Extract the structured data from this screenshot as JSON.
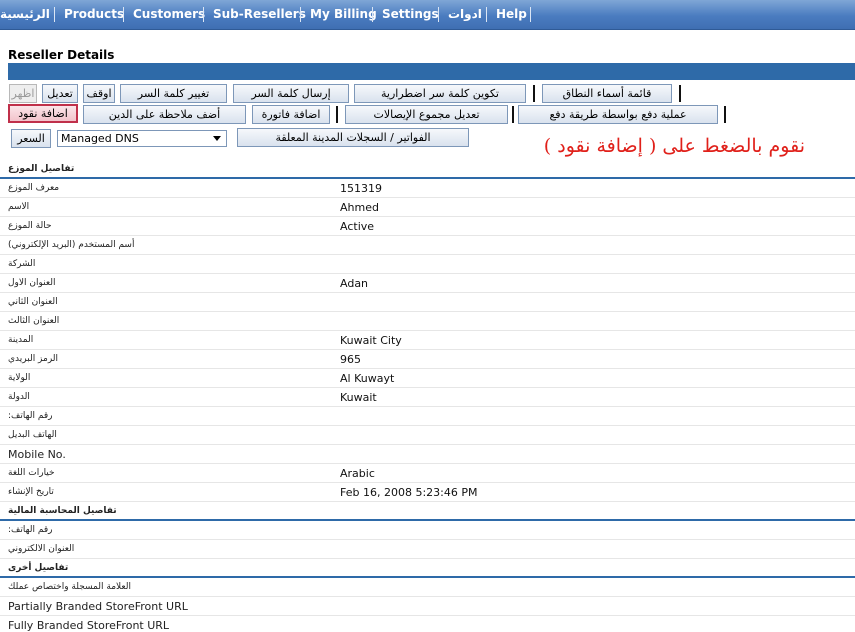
{
  "nav": {
    "items": [
      "الرئيسية",
      "Products",
      "Customers",
      "Sub-Resellers",
      "My Billing",
      "Settings",
      "ادوات",
      "Help"
    ]
  },
  "page": {
    "title": "Reseller Details"
  },
  "actions": {
    "row1": {
      "show": "اظهر",
      "edit": "تعديل",
      "suspend": "اوقف",
      "change_password": "تغيير كلمة السر",
      "send_password": "إرسال كلمة السر",
      "generate_random_password": "تكوين كلمة سر اضطرارية",
      "domain_names_list": "قائمة أسماء النطاق"
    },
    "row2": {
      "add_funds": "اضافة نقود",
      "add_debit_note": "أضف ملاحظة على الدين",
      "add_invoice": "اضافة فاتورة",
      "modify_receipts_total": "تعديل مجموع الإيصالات",
      "payment_by_method": "عملية دفع بواسطة طريقة دفع"
    },
    "row3": {
      "price": "السعر",
      "product_select_value": "Managed DNS",
      "open_invoices": "الفواتير / السجلات المدينة المعلقة"
    }
  },
  "annotation": "نقوم  بالضغط على ( إضافة نقود )",
  "details": [
    {
      "label": "تفاصيل الموزع",
      "value": "",
      "section": true
    },
    {
      "label": "معرف الموزع",
      "value": "151319"
    },
    {
      "label": "الاسم",
      "value": "Ahmed"
    },
    {
      "label": "حالة الموزع",
      "value": "Active"
    },
    {
      "label": "(أسم المستخدم (البريد الإلكتروني",
      "value": ""
    },
    {
      "label": "الشركة",
      "value": ""
    },
    {
      "label": "العنوان الاول",
      "value": "Adan"
    },
    {
      "label": "العنوان الثاني",
      "value": ""
    },
    {
      "label": "العنوان الثالث",
      "value": ""
    },
    {
      "label": "المدينة",
      "value": "Kuwait City"
    },
    {
      "label": "الرمز البريدي",
      "value": "965"
    },
    {
      "label": "الولاية",
      "value": "Al Kuwayt"
    },
    {
      "label": "الدولة",
      "value": "Kuwait"
    },
    {
      "label": ":رقم الهاتف",
      "value": ""
    },
    {
      "label": "الهاتف البديل",
      "value": ""
    },
    {
      "label": "Mobile No.",
      "value": "",
      "en": true
    },
    {
      "label": "خيارات اللغة",
      "value": "Arabic"
    },
    {
      "label": "تاريخ الإنشاء",
      "value": "Feb 16, 2008 5:23:46 PM"
    },
    {
      "label": "تفاصيل المحاسبة المالية",
      "value": "",
      "section": true
    },
    {
      "label": ":رقم الهاتف",
      "value": ""
    },
    {
      "label": "العنوان الالكتروني",
      "value": ""
    },
    {
      "label": "تفاصيل أخرى",
      "value": "",
      "section": true
    },
    {
      "label": "العلامة المسجلة واختصاص عملك",
      "value": ""
    },
    {
      "label": "Partially Branded StoreFront URL",
      "value": "",
      "en": true
    },
    {
      "label": "Fully Branded StoreFront URL",
      "value": "",
      "en": true
    }
  ],
  "colors": {
    "nav_bg": "#4a7cc0",
    "bar_blue": "#2e6aa8",
    "annotation_red": "#e0201a",
    "highlight_border": "#c0304a"
  }
}
